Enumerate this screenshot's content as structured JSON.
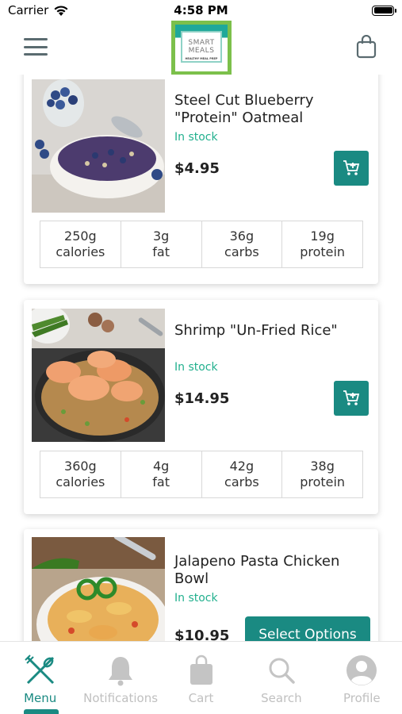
{
  "status_bar": {
    "carrier": "Carrier",
    "time": "4:58 PM"
  },
  "header": {
    "logo_line1": "SMART",
    "logo_line2": "MEALS",
    "logo_tagline": "HEALTHY MEAL PREP"
  },
  "products": [
    {
      "title": "Steel Cut Blueberry \"Protein\" Oatmeal",
      "stock": "In stock",
      "price": "$4.95",
      "action": "add-to-cart",
      "nutrition": [
        {
          "value": "250g",
          "label": "calories"
        },
        {
          "value": "3g",
          "label": "fat"
        },
        {
          "value": "36g",
          "label": "carbs"
        },
        {
          "value": "19g",
          "label": "protein"
        }
      ]
    },
    {
      "title": "Shrimp \"Un-Fried Rice\"",
      "stock": "In stock",
      "price": "$14.95",
      "action": "add-to-cart",
      "nutrition": [
        {
          "value": "360g",
          "label": "calories"
        },
        {
          "value": "4g",
          "label": "fat"
        },
        {
          "value": "42g",
          "label": "carbs"
        },
        {
          "value": "38g",
          "label": "protein"
        }
      ]
    },
    {
      "title": "Jalapeno Pasta Chicken Bowl",
      "stock": "In stock",
      "price": "$10.95",
      "action_label": "Select Options"
    }
  ],
  "tabs": [
    {
      "label": "Menu",
      "icon": "utensils-icon",
      "active": true
    },
    {
      "label": "Notifications",
      "icon": "bell-icon",
      "active": false
    },
    {
      "label": "Cart",
      "icon": "shopping-bag-icon",
      "active": false
    },
    {
      "label": "Search",
      "icon": "search-icon",
      "active": false
    },
    {
      "label": "Profile",
      "icon": "profile-icon",
      "active": false
    }
  ],
  "colors": {
    "accent": "#1a8a82",
    "stock": "#22b08e",
    "inactive_tab": "#c0c0c0",
    "logo_green": "#7cc04b"
  }
}
